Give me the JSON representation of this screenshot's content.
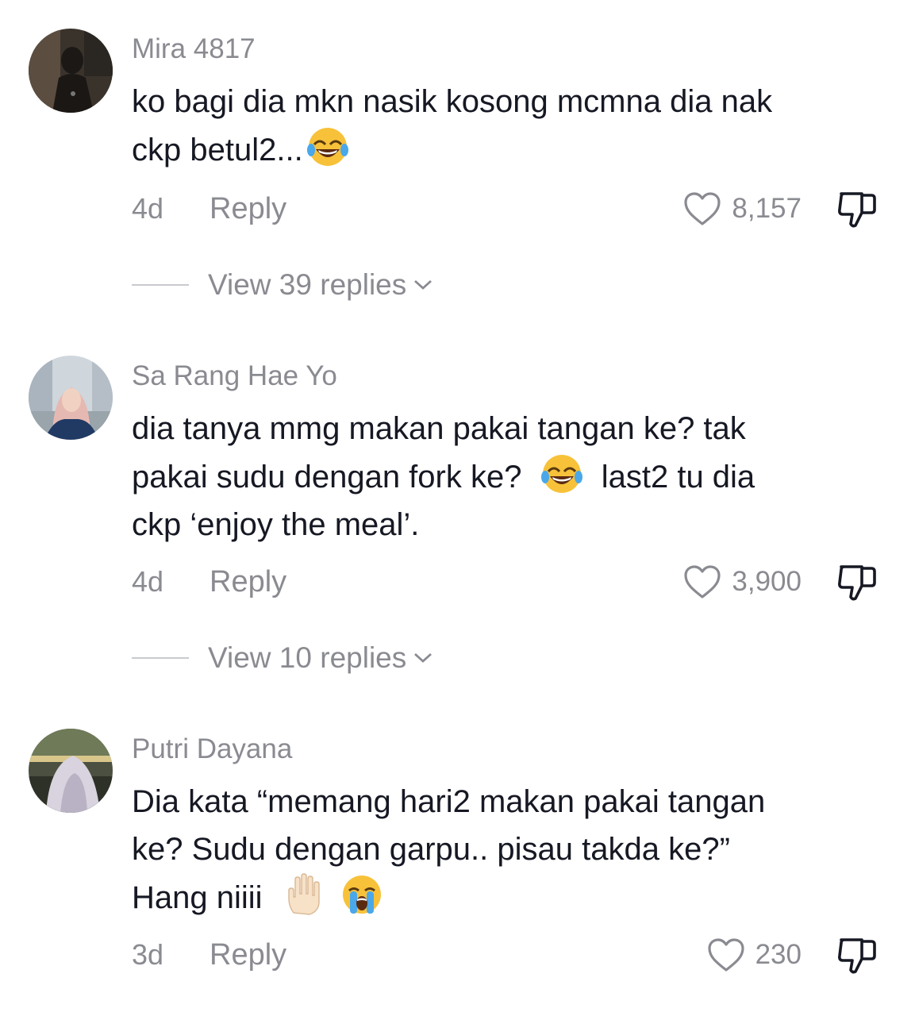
{
  "comments": [
    {
      "username": "Mira 4817",
      "lines": [
        {
          "before": "ko bagi dia mkn nasik kosong mcmna dia nak",
          "after": ""
        },
        {
          "before": "ckp betul2...",
          "after": ""
        }
      ],
      "emojis": [
        "face-with-tears-of-joy"
      ],
      "age": "4d",
      "reply_label": "Reply",
      "likes": "8,157",
      "view_replies": "View 39 replies"
    },
    {
      "username": "Sa Rang Hae Yo",
      "lines": [
        {
          "before": "dia tanya mmg makan pakai tangan ke? tak",
          "after": ""
        },
        {
          "before": "pakai sudu dengan fork ke?",
          "after": "last2 tu dia"
        },
        {
          "before": "ckp ‘enjoy the meal’.",
          "after": ""
        }
      ],
      "emojis": [
        "face-with-tears-of-joy"
      ],
      "age": "4d",
      "reply_label": "Reply",
      "likes": "3,900",
      "view_replies": "View 10 replies"
    },
    {
      "username": "Putri Dayana",
      "lines": [
        {
          "before": "Dia kata “memang hari2 makan pakai tangan",
          "after": ""
        },
        {
          "before": "ke? Sudu dengan garpu.. pisau takda ke?”",
          "after": ""
        },
        {
          "before": "Hang niiii",
          "after": ""
        }
      ],
      "emojis": [
        "raised-hand",
        "loudly-crying-face"
      ],
      "age": "3d",
      "reply_label": "Reply",
      "likes": "230"
    }
  ],
  "icons": {
    "like": "heart-outline-icon",
    "dislike": "thumbs-down-icon",
    "expand": "chevron-down-icon"
  },
  "colors": {
    "secondary_text": "#8a8b91",
    "primary_text": "#161823"
  }
}
